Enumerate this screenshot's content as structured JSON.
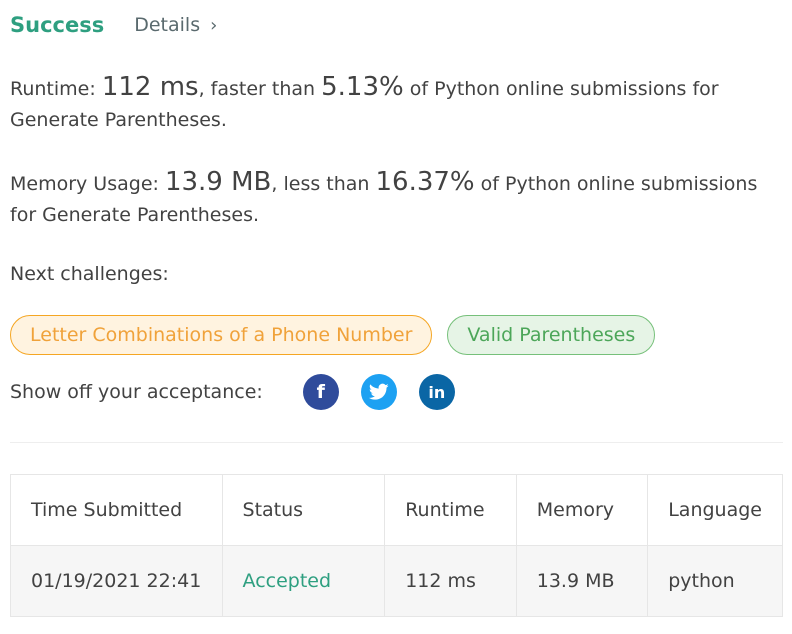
{
  "header": {
    "status": "Success",
    "details_label": "Details",
    "chevron": "›"
  },
  "runtime": {
    "label": "Runtime: ",
    "value": "112 ms",
    "mid": ", faster than ",
    "percent": "5.13%",
    "tail": " of Python online submissions for Generate Parentheses."
  },
  "memory": {
    "label": "Memory Usage: ",
    "value": "13.9 MB",
    "mid": ", less than ",
    "percent": "16.37%",
    "tail": " of Python online submissions for Generate Parentheses."
  },
  "next": {
    "label": "Next challenges:",
    "challenges": [
      "Letter Combinations of a Phone Number",
      "Valid Parentheses"
    ]
  },
  "share": {
    "label": "Show off your acceptance:",
    "icons": {
      "facebook": "f",
      "twitter": "t",
      "linkedin": "in"
    }
  },
  "table": {
    "headers": [
      "Time Submitted",
      "Status",
      "Runtime",
      "Memory",
      "Language"
    ],
    "row": [
      "01/19/2021 22:41",
      "Accepted",
      "112 ms",
      "13.9 MB",
      "python"
    ]
  },
  "colors": {
    "success": "#2e9f80",
    "orange": "#f5a623",
    "green": "#76c07a"
  }
}
